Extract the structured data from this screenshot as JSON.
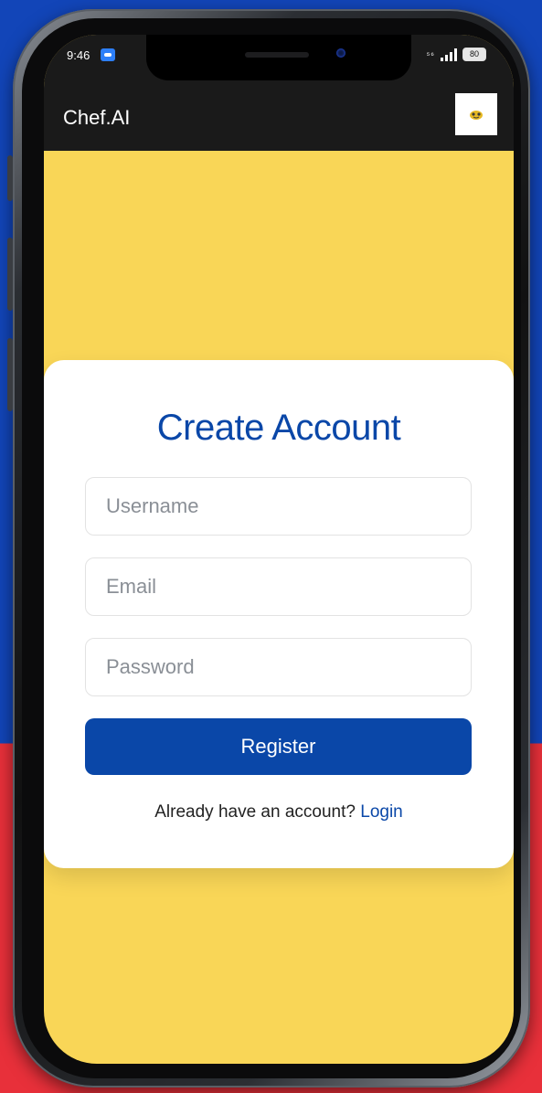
{
  "status_bar": {
    "time": "9:46",
    "network_label": "⁵⁶",
    "battery": "80"
  },
  "app_bar": {
    "title": "Chef.AI"
  },
  "form": {
    "title": "Create Account",
    "username_placeholder": "Username",
    "email_placeholder": "Email",
    "password_placeholder": "Password",
    "register_label": "Register",
    "prompt_text": "Already have an account?",
    "login_label": "Login"
  },
  "icons": {
    "avatar": "chef-avatar-icon",
    "app_notification": "message-icon",
    "signal": "signal-icon",
    "battery": "battery-icon"
  },
  "colors": {
    "primary": "#0a47a8",
    "background": "#f9d657",
    "app_bar": "#1a1a1a",
    "card": "#ffffff"
  }
}
